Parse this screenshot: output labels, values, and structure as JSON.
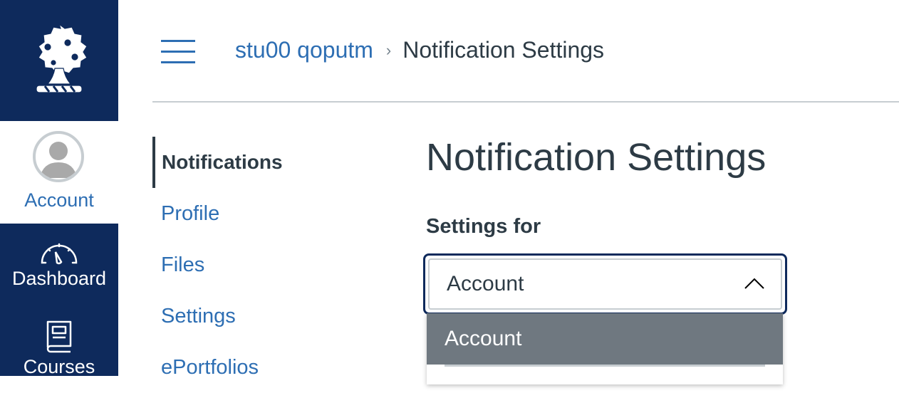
{
  "global_nav": {
    "logo_icon": "oak-tree-logo-icon",
    "account": {
      "label": "Account",
      "icon": "user-avatar-icon"
    },
    "items": [
      {
        "label": "Dashboard",
        "icon": "speedometer-icon"
      },
      {
        "label": "Courses",
        "icon": "book-icon"
      }
    ]
  },
  "header": {
    "menu_icon": "hamburger-icon",
    "breadcrumb": [
      {
        "label": "stu00 qoputm",
        "link": true
      },
      {
        "label": "Notification Settings",
        "link": false
      }
    ],
    "separator": "›"
  },
  "section_nav": {
    "items": [
      {
        "label": "Notifications",
        "active": true
      },
      {
        "label": "Profile",
        "active": false
      },
      {
        "label": "Files",
        "active": false
      },
      {
        "label": "Settings",
        "active": false
      },
      {
        "label": "ePortfolios",
        "active": false
      }
    ]
  },
  "main": {
    "title": "Notification Settings",
    "settings_for_label": "Settings for",
    "select": {
      "value": "Account",
      "expanded": true,
      "options": [
        {
          "label": "Account",
          "highlighted": true
        }
      ]
    }
  },
  "colors": {
    "nav_bg": "#0e2a5c",
    "link": "#2d6eb3",
    "text": "#2d3b45",
    "highlight": "#6f7880",
    "border": "#c7cdd1"
  }
}
